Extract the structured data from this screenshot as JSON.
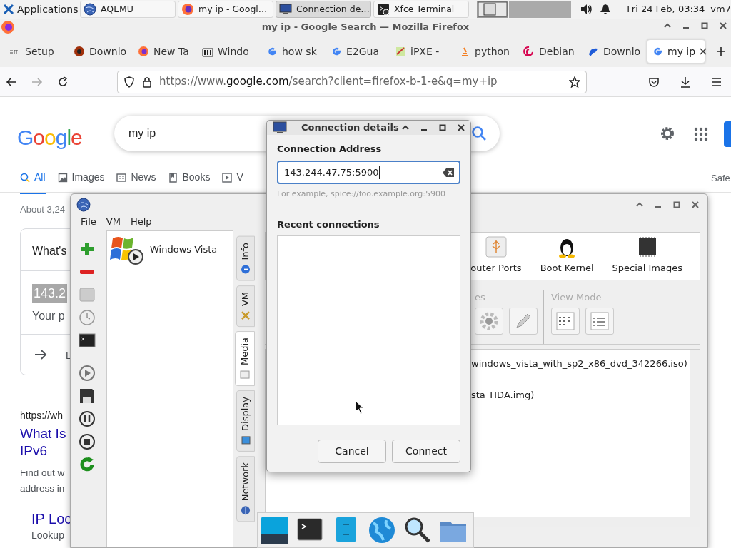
{
  "panel": {
    "apps_label": "Applications",
    "tasks": [
      {
        "label": "AQEMU",
        "selected": false
      },
      {
        "label": "my ip - Googl…",
        "selected": false
      },
      {
        "label": "Connection de…",
        "selected": true
      },
      {
        "label": "Xfce Terminal",
        "selected": false
      }
    ],
    "clock": "Fri 24 Feb, 03:34",
    "user": "vm7"
  },
  "firefox": {
    "title": "my ip - Google Search — Mozilla Firefox",
    "tabs": [
      {
        "label": "Setup",
        "selected": false
      },
      {
        "label": "Downlo",
        "selected": false
      },
      {
        "label": "New Ta",
        "selected": false
      },
      {
        "label": "Windo",
        "selected": false
      },
      {
        "label": "how sk",
        "selected": false
      },
      {
        "label": "E2Gua",
        "selected": false
      },
      {
        "label": "iPXE -",
        "selected": false
      },
      {
        "label": "python",
        "selected": false
      },
      {
        "label": "Debian",
        "selected": false
      },
      {
        "label": "Downlo",
        "selected": false
      },
      {
        "label": "my ip",
        "selected": true
      }
    ],
    "url": [
      {
        "text": "https://www.",
        "emphasis": false
      },
      {
        "text": "google.com",
        "emphasis": true
      },
      {
        "text": "/search?client=firefox-b-1-e&q=my+ip",
        "emphasis": false
      }
    ]
  },
  "google": {
    "logo": "Google",
    "query": "my ip",
    "tabs": [
      {
        "label": "All",
        "selected": true
      },
      {
        "label": "Images",
        "selected": false
      },
      {
        "label": "News",
        "selected": false
      },
      {
        "label": "Books",
        "selected": false
      },
      {
        "label": "V",
        "selected": false
      }
    ],
    "safe": "Safe",
    "stats": "About 3,24",
    "card": {
      "title": "What's",
      "ip": "143.2",
      "subtitle": "Your p",
      "link": "L"
    },
    "result": {
      "url": "https://wh",
      "title_lines": [
        "What Is",
        "IPv6"
      ],
      "snippet_lines": [
        "Find out w",
        "address in"
      ]
    },
    "sublink": {
      "title": "IP Loc",
      "snippet": "Lookup"
    }
  },
  "aqemu": {
    "menu": [
      "File",
      "VM",
      "Help"
    ],
    "vms": [
      {
        "name": "Windows Vista"
      }
    ],
    "side_tabs": [
      {
        "label": "Info",
        "selected": false
      },
      {
        "label": "VM",
        "selected": false
      },
      {
        "label": "Media",
        "selected": true
      },
      {
        "label": "Display",
        "selected": false
      },
      {
        "label": "Network",
        "selected": false
      }
    ],
    "devices": [
      "outer Ports",
      "Boot Kernel",
      "Special Images"
    ],
    "groups": [
      "es",
      "View Mode"
    ],
    "media": [
      "windows_vista_with_sp2_x86_dvd_342266.iso)",
      "sta_HDA.img)"
    ]
  },
  "dialog": {
    "title": "Connection details",
    "address_label": "Connection Address",
    "address": "143.244.47.75:5900",
    "hint": "For example, spice://foo.example.org:5900",
    "recent_label": "Recent connections",
    "buttons": [
      "Cancel",
      "Connect"
    ]
  }
}
